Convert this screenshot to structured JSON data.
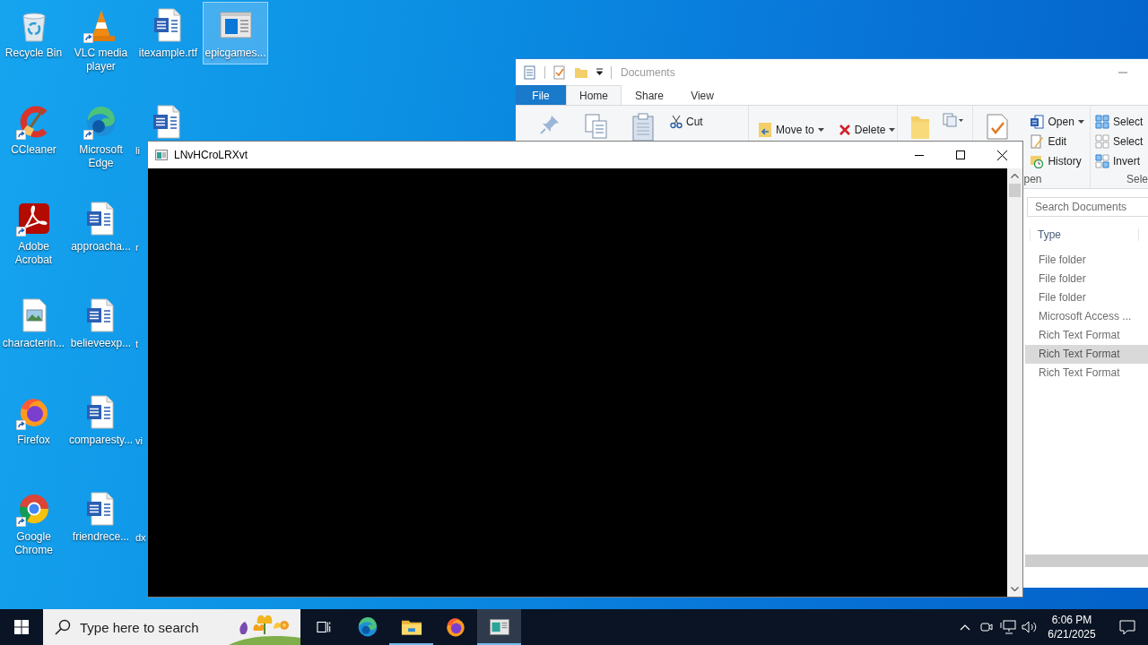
{
  "desktop": {
    "columns": [
      {
        "items": [
          {
            "label": "Recycle Bin",
            "kind": "recycle",
            "shortcut": false,
            "selected": false,
            "truncated": false
          },
          {
            "label": "CCleaner",
            "kind": "ccleaner",
            "shortcut": true,
            "selected": false,
            "truncated": false
          },
          {
            "label": "Adobe Acrobat",
            "kind": "acrobat",
            "shortcut": true,
            "selected": false,
            "truncated": false
          },
          {
            "label": "characterin...",
            "kind": "image_file",
            "shortcut": false,
            "selected": false,
            "truncated": false
          },
          {
            "label": "Firefox",
            "kind": "firefox",
            "shortcut": true,
            "selected": false,
            "truncated": false
          },
          {
            "label": "Google Chrome",
            "kind": "chrome",
            "shortcut": true,
            "selected": false,
            "truncated": false
          }
        ]
      },
      {
        "items": [
          {
            "label": "VLC media player",
            "kind": "vlc",
            "shortcut": true,
            "selected": false,
            "truncated": false
          },
          {
            "label": "Microsoft Edge",
            "kind": "edge",
            "shortcut": true,
            "selected": false,
            "truncated": false
          },
          {
            "label": "approacha...",
            "kind": "word",
            "shortcut": false,
            "selected": false,
            "truncated": false
          },
          {
            "label": "believeexp...",
            "kind": "word",
            "shortcut": false,
            "selected": false,
            "truncated": false
          },
          {
            "label": "comparesty...",
            "kind": "word",
            "shortcut": false,
            "selected": false,
            "truncated": false
          },
          {
            "label": "friendrece...",
            "kind": "word",
            "shortcut": false,
            "selected": false,
            "truncated": false
          }
        ]
      },
      {
        "items": [
          {
            "label": "itexample.rtf",
            "kind": "word",
            "shortcut": false,
            "selected": false,
            "truncated": false
          },
          {
            "label": "li",
            "kind": "word",
            "shortcut": false,
            "selected": false,
            "truncated": true
          },
          {
            "label": "r",
            "kind": "hidden",
            "shortcut": false,
            "selected": false,
            "truncated": true
          },
          {
            "label": "t",
            "kind": "hidden",
            "shortcut": false,
            "selected": false,
            "truncated": true
          },
          {
            "label": "vi",
            "kind": "hidden",
            "shortcut": false,
            "selected": false,
            "truncated": true
          },
          {
            "label": "dx",
            "kind": "hidden",
            "shortcut": false,
            "selected": false,
            "truncated": true
          }
        ]
      },
      {
        "items": [
          {
            "label": "epicgames...",
            "kind": "app_window",
            "shortcut": false,
            "selected": true,
            "truncated": false
          }
        ]
      }
    ]
  },
  "explorer": {
    "title": "Documents",
    "tabs": [
      {
        "label": "File",
        "kind": "file",
        "selected": false
      },
      {
        "label": "Home",
        "kind": "tab",
        "selected": true
      },
      {
        "label": "Share",
        "kind": "tab",
        "selected": false
      },
      {
        "label": "View",
        "kind": "tab",
        "selected": false
      }
    ],
    "ribbon": {
      "cut": "Cut",
      "move_to": "Move to",
      "delete": "Delete",
      "open": "Open",
      "edit": "Edit",
      "history": "History",
      "open_group": "pen",
      "select_all": "Select",
      "select_none": "Select",
      "invert_selection": "Invert",
      "select_group": "Sele"
    },
    "search": {
      "placeholder": "Search Documents"
    },
    "columns": [
      "Type"
    ],
    "rows": [
      {
        "type": "File folder",
        "selected": false
      },
      {
        "type": "File folder",
        "selected": false
      },
      {
        "type": "File folder",
        "selected": false
      },
      {
        "type": "Microsoft Access ...",
        "selected": false
      },
      {
        "type": "Rich Text Format",
        "selected": false
      },
      {
        "type": "Rich Text Format",
        "selected": true
      },
      {
        "type": "Rich Text Format",
        "selected": false
      }
    ]
  },
  "console": {
    "title": "LNvHCroLRXvt"
  },
  "taskbar": {
    "search": {
      "placeholder": "Type here to search"
    },
    "apps": [
      {
        "kind": "task_view",
        "running": false,
        "active": false
      },
      {
        "kind": "edge",
        "running": false,
        "active": false
      },
      {
        "kind": "explorer",
        "running": true,
        "active": false
      },
      {
        "kind": "firefox",
        "running": false,
        "active": false
      },
      {
        "kind": "console",
        "running": true,
        "active": true
      }
    ],
    "time": "6:06 PM",
    "date": "6/21/2025"
  }
}
